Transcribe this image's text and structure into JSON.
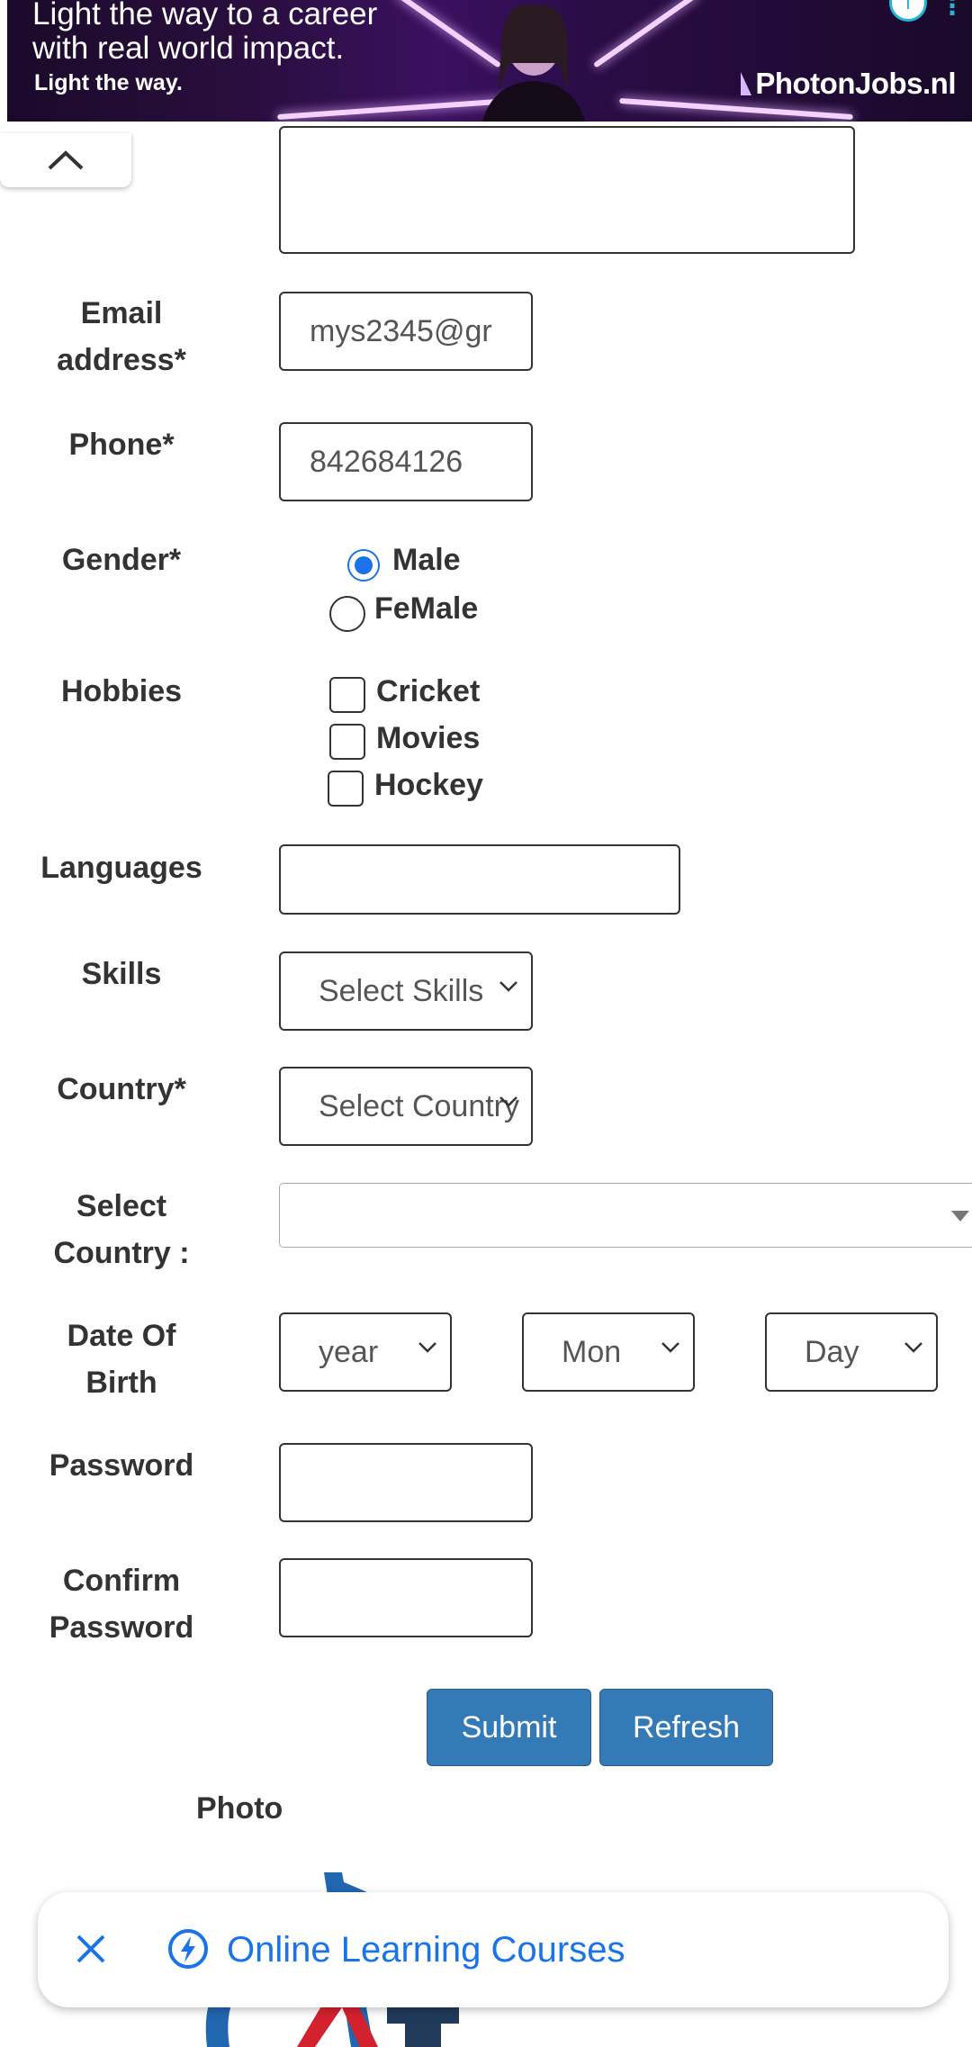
{
  "ad": {
    "line1": "Light the way to a career",
    "line2": "with real world impact.",
    "tagline": "Light the way.",
    "brand": "PhotonJobs.nl",
    "info_icon": "info-icon",
    "more_icon": "more-icon"
  },
  "form": {
    "email": {
      "label": "Email address*",
      "value": "mys2345@gr"
    },
    "phone": {
      "label": "Phone*",
      "value": "842684126"
    },
    "gender": {
      "label": "Gender*",
      "options": [
        "Male",
        "FeMale"
      ],
      "selected": "Male"
    },
    "hobbies": {
      "label": "Hobbies",
      "options": [
        "Cricket",
        "Movies",
        "Hockey"
      ]
    },
    "languages": {
      "label": "Languages",
      "value": ""
    },
    "skills": {
      "label": "Skills",
      "value": "Select Skills"
    },
    "country": {
      "label": "Country*",
      "value": "Select Country"
    },
    "select_country": {
      "label": "Select Country :",
      "value": ""
    },
    "dob": {
      "label": "Date Of Birth",
      "year": "year",
      "month": "Mon",
      "day": "Day"
    },
    "password": {
      "label": "Password",
      "value": ""
    },
    "confirm_password": {
      "label": "Confirm Password",
      "value": ""
    },
    "submit_label": "Submit",
    "refresh_label": "Refresh",
    "photo_label": "Photo"
  },
  "toast": {
    "text": "Online Learning Courses"
  },
  "colors": {
    "button": "#337ab7",
    "accent": "#1a73e8",
    "ad_bg": "#2a0e3e"
  }
}
